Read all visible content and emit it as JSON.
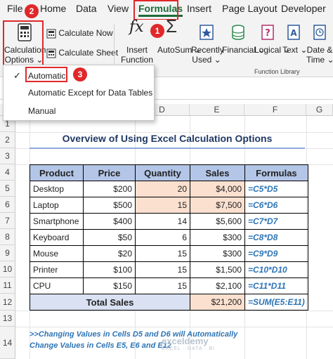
{
  "menu": {
    "tabs": [
      {
        "label": "File"
      },
      {
        "label": "Home"
      },
      {
        "label": "Data"
      },
      {
        "label": "View"
      },
      {
        "label": "Formulas"
      },
      {
        "label": "Insert"
      },
      {
        "label": "Page Layout"
      },
      {
        "label": "Developer"
      }
    ]
  },
  "ribbon": {
    "calc_options_line1": "Calculation",
    "calc_options_line2": "Options",
    "calc_now": "Calculate Now",
    "calc_sheet": "Calculate Sheet",
    "insert_function_line1": "Insert",
    "insert_function_line2": "Function",
    "autosum": "AutoSum",
    "recently_line1": "Recently",
    "recently_line2": "Used",
    "financial": "Financial",
    "logical": "Logical",
    "text": "Text",
    "datetime_line1": "Date &",
    "datetime_line2": "Time",
    "group_label": "Function Library",
    "fx_glyph": "fx"
  },
  "badges": {
    "b1": "1",
    "b2": "2",
    "b3": "3"
  },
  "dropdown": {
    "check": "✓",
    "items": [
      {
        "label": "Automatic"
      },
      {
        "label": "Automatic Except for Data Tables"
      },
      {
        "label": "Manual"
      }
    ]
  },
  "grid": {
    "columns": [
      "D",
      "E",
      "F",
      "G"
    ],
    "rows": [
      "1",
      "2",
      "3",
      "4",
      "5",
      "6",
      "7",
      "8",
      "9",
      "10",
      "11",
      "12",
      "13",
      "14"
    ]
  },
  "sheet": {
    "title": "Overview of Using Excel Calculation Options",
    "headers": [
      "Product",
      "Price",
      "Quantity",
      "Sales",
      "Formulas"
    ],
    "rows": [
      [
        "Desktop",
        "$200",
        "20",
        "$4,000",
        "=C5*D5"
      ],
      [
        "Laptop",
        "$500",
        "15",
        "$7,500",
        "=C6*D6"
      ],
      [
        "Smartphone",
        "$400",
        "14",
        "$5,600",
        "=C7*D7"
      ],
      [
        "Keyboard",
        "$50",
        "6",
        "$300",
        "=C8*D8"
      ],
      [
        "Mouse",
        "$20",
        "15",
        "$300",
        "=C9*D9"
      ],
      [
        "Printer",
        "$100",
        "15",
        "$1,500",
        "=C10*D10"
      ],
      [
        "CPU",
        "$150",
        "15",
        "$2,100",
        "=C11*D11"
      ]
    ],
    "total_label": "Total Sales",
    "total_value": "$21,200",
    "total_formula": "=SUM(E5:E11)",
    "note_line1": ">>Changing Values in Cells D5 and D6 will Automatically",
    "note_line2": "Change Values in Cells E5, E6 and E12",
    "watermark": "exceldemy",
    "watermark_sub": "EXCEL · DATA · BI"
  },
  "colors": {
    "accent": "#1e6b3a",
    "highlight": "#e0282b",
    "formula": "#2e75b6",
    "header_fill": "#b4c6e7",
    "peach": "#fbe0d0"
  }
}
